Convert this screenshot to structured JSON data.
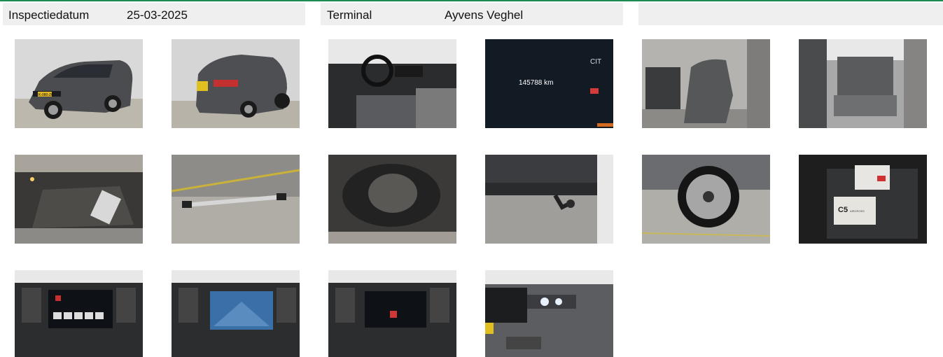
{
  "header": {
    "inspection_date_label": "Inspectiedatum",
    "inspection_date_value": "25-03-2025",
    "terminal_label": "Terminal",
    "terminal_value": "Ayvens Veghel"
  },
  "photos": {
    "odometer_reading": "145788 km",
    "manual_booklet_text": "C5",
    "manual_booklet_subtext": "AIRCROSS",
    "licence_plate_text": "K-080-ZG"
  },
  "colors": {
    "accent_rule": "#1f8a52",
    "header_cell_bg": "#efefef"
  }
}
